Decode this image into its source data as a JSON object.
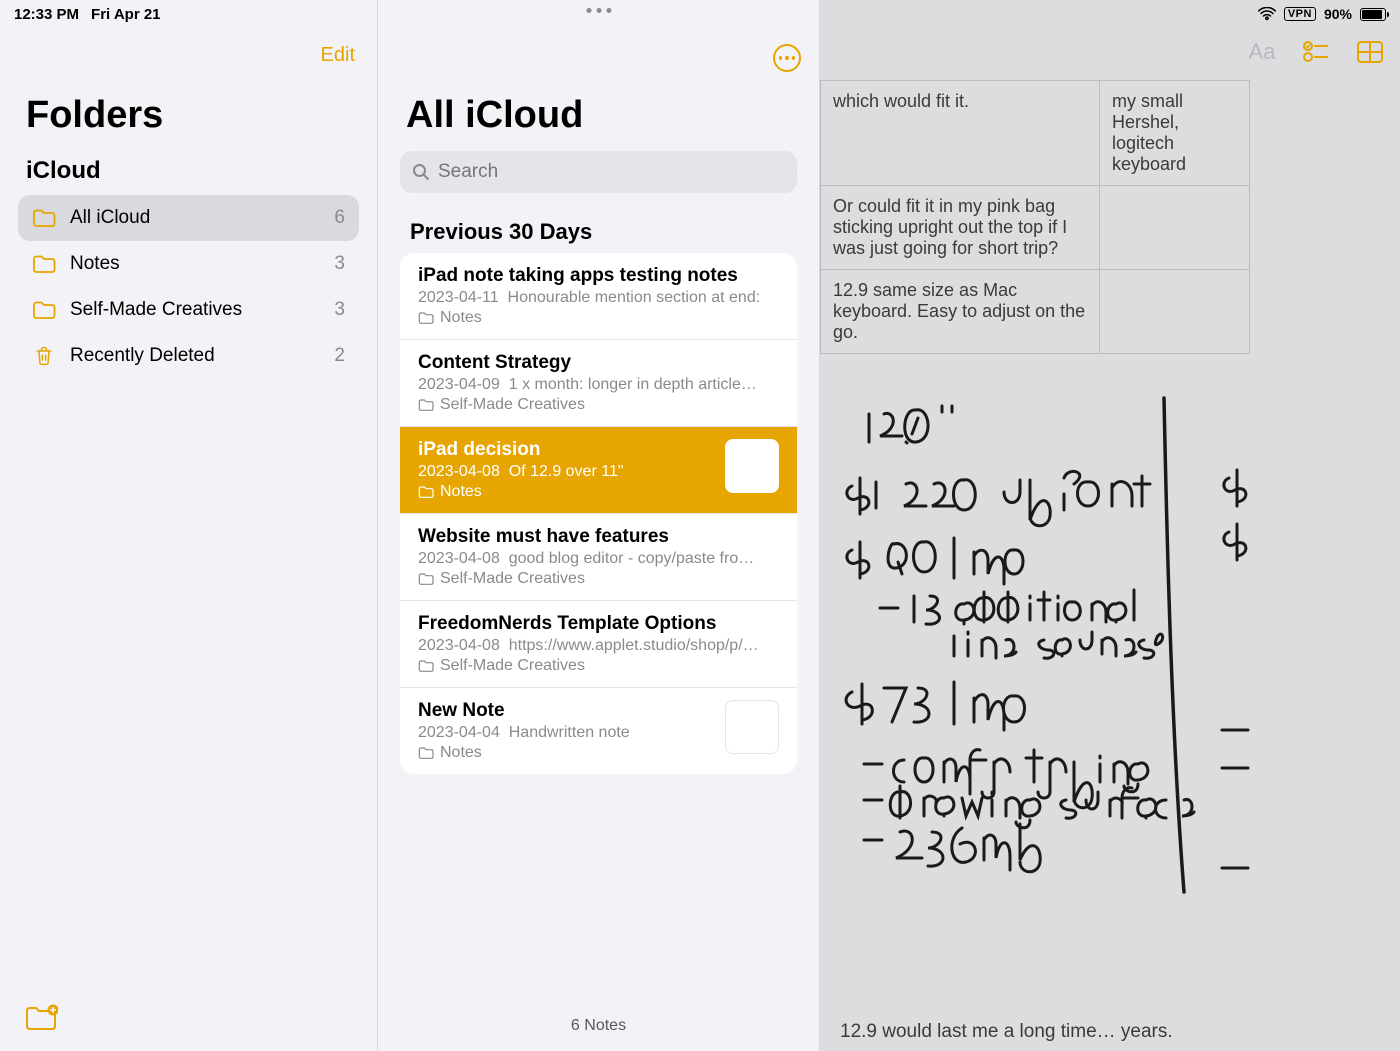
{
  "status": {
    "time": "12:33 PM",
    "date": "Fri Apr 21",
    "vpn": "VPN",
    "battery_pct": "90%"
  },
  "folders": {
    "edit": "Edit",
    "title": "Folders",
    "account": "iCloud",
    "items": [
      {
        "label": "All iCloud",
        "count": "6",
        "icon": "folder",
        "selected": true
      },
      {
        "label": "Notes",
        "count": "3",
        "icon": "folder",
        "selected": false
      },
      {
        "label": "Self-Made Creatives",
        "count": "3",
        "icon": "folder",
        "selected": false
      },
      {
        "label": "Recently Deleted",
        "count": "2",
        "icon": "trash",
        "selected": false
      }
    ]
  },
  "notes": {
    "title": "All iCloud",
    "search_placeholder": "Search",
    "section": "Previous 30 Days",
    "count_label": "6 Notes",
    "items": [
      {
        "title": "iPad note taking apps testing notes",
        "date": "2023-04-11",
        "preview": "Honourable mention section at end:",
        "folder": "Notes",
        "selected": false,
        "thumb": false
      },
      {
        "title": "Content Strategy",
        "date": "2023-04-09",
        "preview": "1 x month: longer in depth article…",
        "folder": "Self-Made Creatives",
        "selected": false,
        "thumb": false
      },
      {
        "title": "iPad decision",
        "date": "2023-04-08",
        "preview": "Of 12.9 over 11\"",
        "folder": "Notes",
        "selected": true,
        "thumb": true
      },
      {
        "title": "Website must have features",
        "date": "2023-04-08",
        "preview": "good blog editor - copy/paste fro…",
        "folder": "Self-Made Creatives",
        "selected": false,
        "thumb": false
      },
      {
        "title": "FreedomNerds Template Options",
        "date": "2023-04-08",
        "preview": "https://www.applet.studio/shop/p/…",
        "folder": "Self-Made Creatives",
        "selected": false,
        "thumb": false
      },
      {
        "title": "New Note",
        "date": "2023-04-04",
        "preview": "Handwritten note",
        "folder": "Notes",
        "selected": false,
        "thumb": true
      }
    ]
  },
  "detail": {
    "table_rows": [
      {
        "a": "which would fit it.",
        "b": "my small Hershel, logitech keyboard"
      },
      {
        "a": "Or could fit it in my pink bag sticking upright out the top if I was just going for short trip?",
        "b": ""
      },
      {
        "a": "12.9 same size as Mac keyboard. Easy to adjust on the go.",
        "b": ""
      }
    ],
    "hand_lines_left": [
      "12.9\"",
      "$1 220 upfront",
      "$ 90/mo",
      "– 15 additional line saunes?",
      "$75/mo",
      "– comfy typing",
      "– drawing surface",
      "– 256mb"
    ],
    "hand_lines_right": [
      "$",
      "$",
      "–",
      "–"
    ],
    "footer": "12.9 would last me a long time… years."
  }
}
